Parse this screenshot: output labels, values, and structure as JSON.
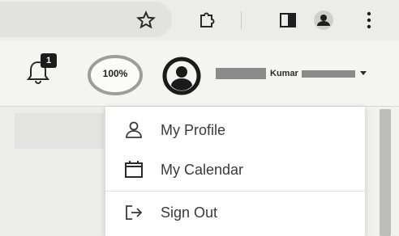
{
  "toolbar": {
    "icons": [
      "star-icon",
      "extension-puzzle-icon",
      "side-panel-icon",
      "profile-icon",
      "more-vert-icon"
    ]
  },
  "header": {
    "notifications": {
      "icon": "bell-icon",
      "count": "1"
    },
    "progress": {
      "label": "100%",
      "value": 1.0
    },
    "user": {
      "icon": "avatar-icon",
      "name": "Kumar",
      "menu_icon": "caret-down-icon"
    }
  },
  "menu": {
    "items": [
      {
        "label": "My Profile",
        "icon": "user-icon"
      },
      {
        "label": "My Calendar",
        "icon": "calendar-icon"
      },
      {
        "label": "Sign Out",
        "icon": "sign-out-icon"
      }
    ]
  },
  "colors": {
    "badge": "#1c1c1c",
    "menu_bg": "#ffffff",
    "text": "#3a3a3a"
  }
}
